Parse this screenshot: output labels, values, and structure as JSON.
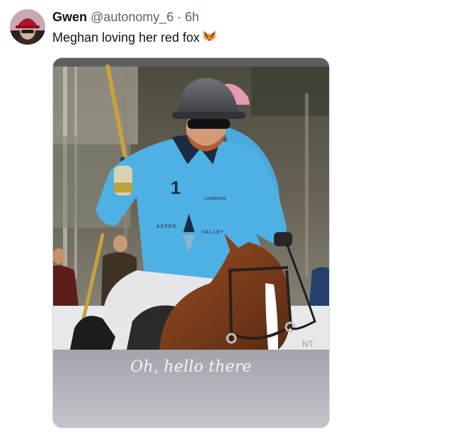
{
  "tweet": {
    "display_name": "Gwen",
    "handle": "@autonomy_6",
    "separator": "·",
    "time": "6h",
    "text": "Meghan loving her red fox",
    "emoji_icon": "fox-face-icon",
    "avatar_icon": "avatar-red-hat"
  },
  "media": {
    "caption": "Oh, hello there",
    "jersey_number": "1",
    "jersey_logo_left": "ASPEN",
    "jersey_logo_right": "VALLEY",
    "jersey_brand": "casablanca",
    "banner_fragment": "NT"
  },
  "colors": {
    "text_primary": "#0f1419",
    "text_secondary": "#536471",
    "jersey_blue": "#4fb0e3"
  }
}
